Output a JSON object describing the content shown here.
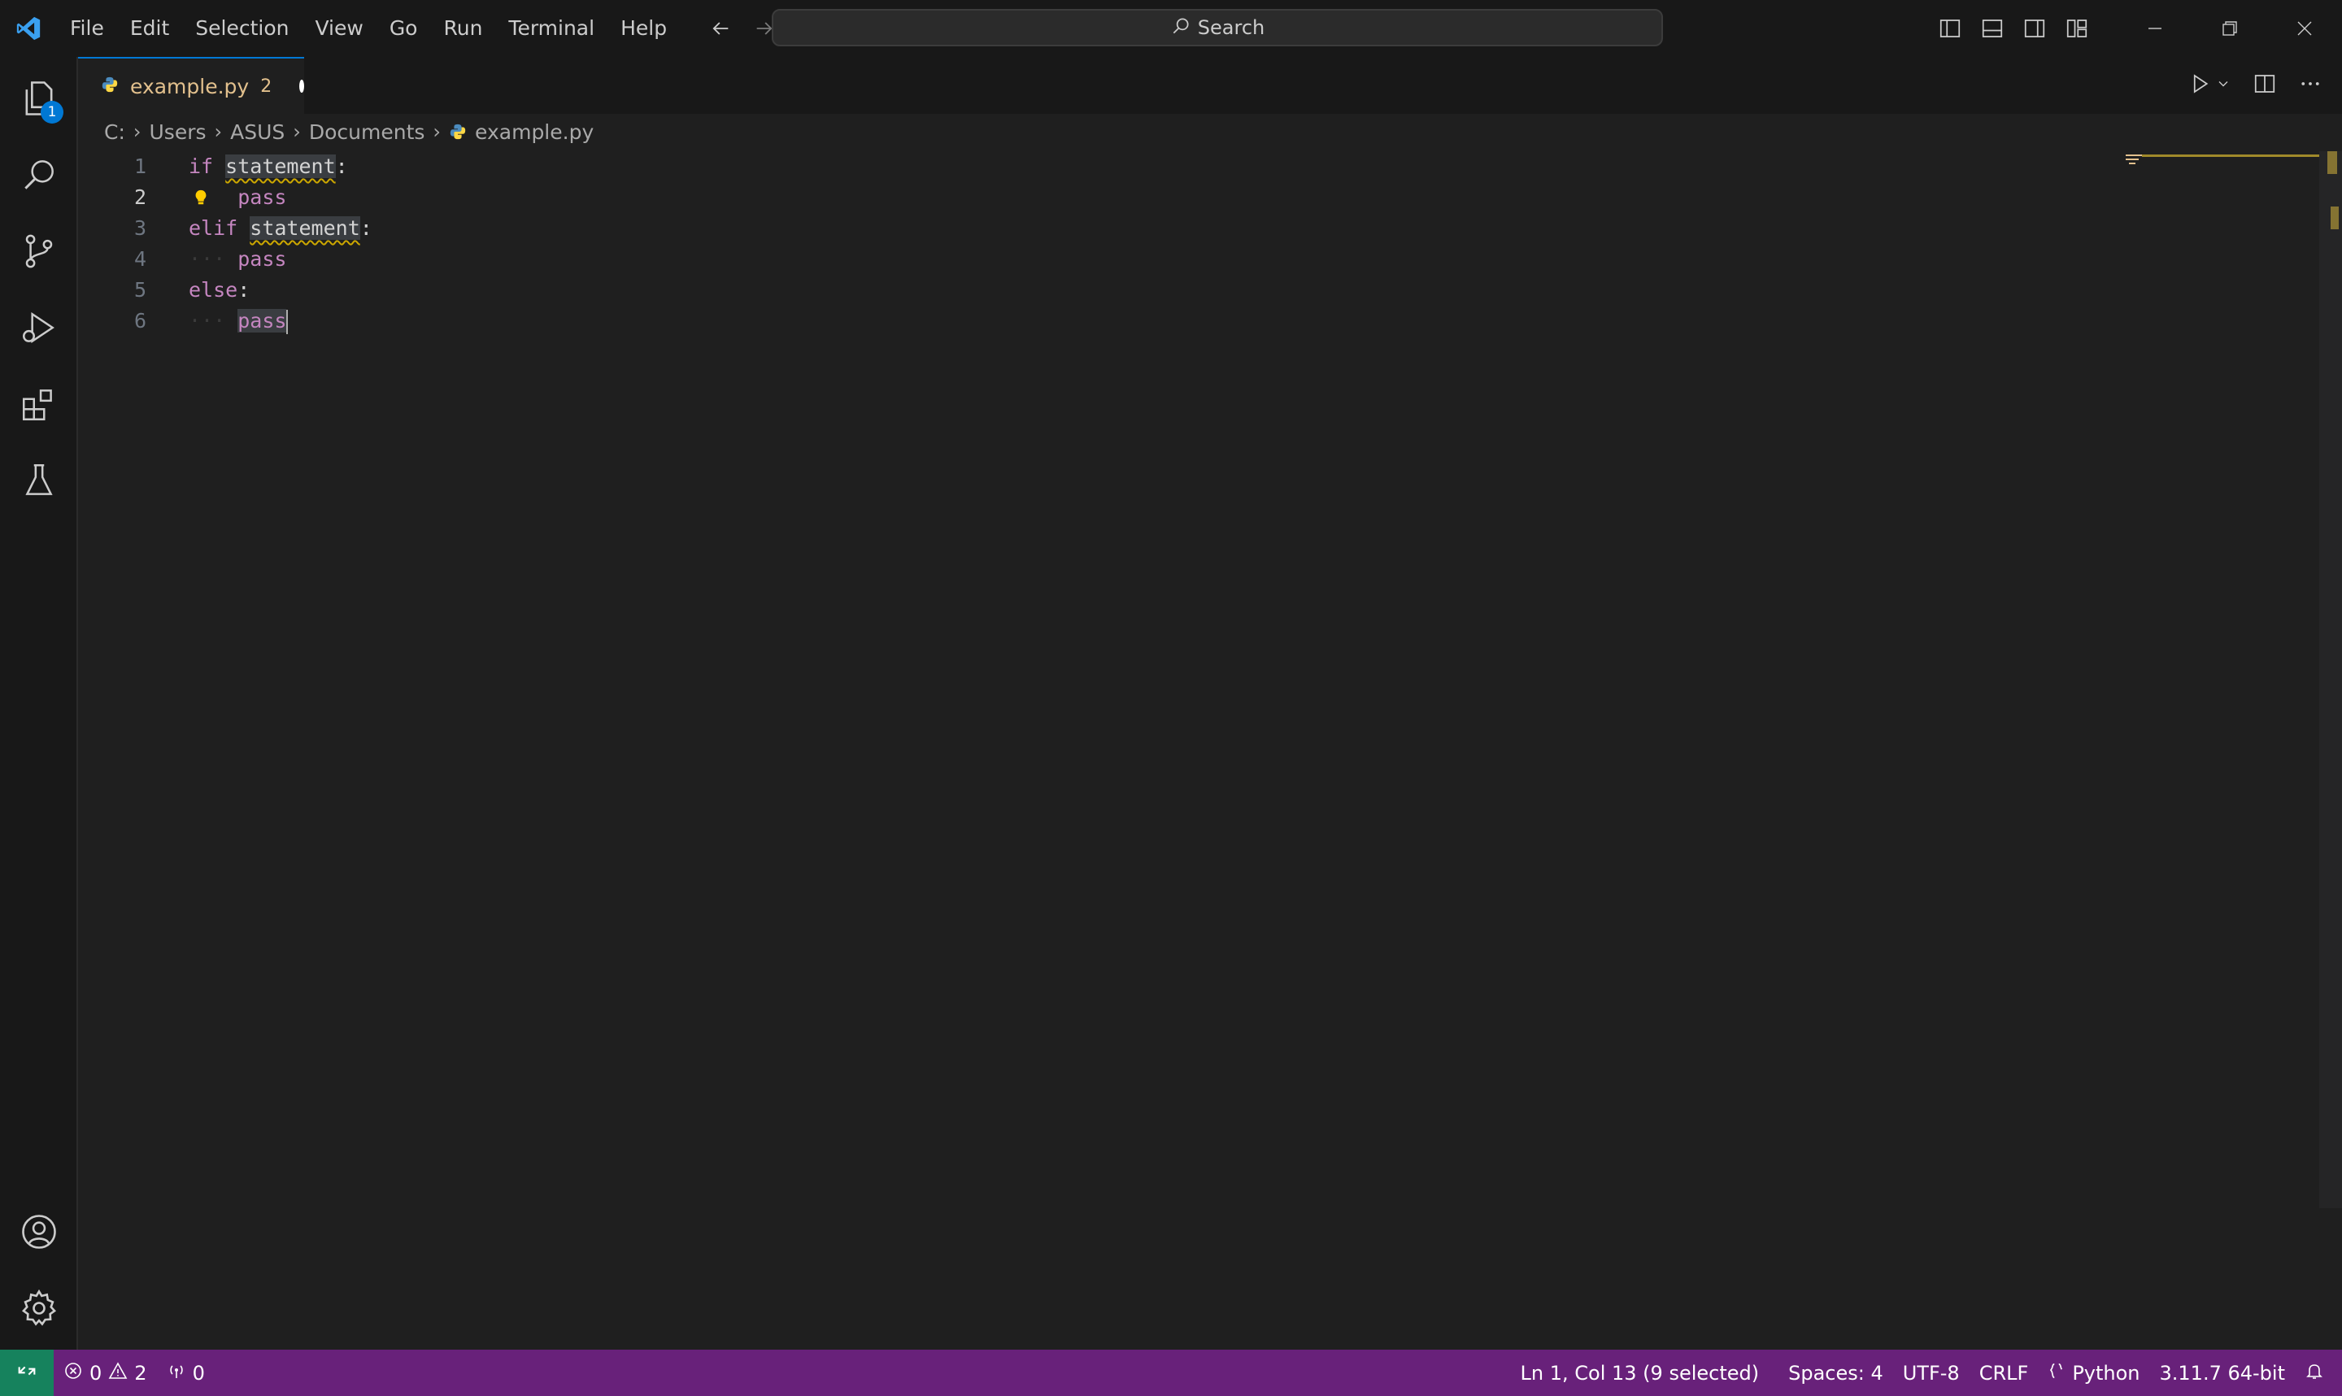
{
  "menu": [
    "File",
    "Edit",
    "Selection",
    "View",
    "Go",
    "Run",
    "Terminal",
    "Help"
  ],
  "search": {
    "label": "Search"
  },
  "activity": {
    "explorer_badge": "1"
  },
  "tab": {
    "name": "example.py",
    "problems": "2"
  },
  "breadcrumb": [
    "C:",
    "Users",
    "ASUS",
    "Documents",
    "example.py"
  ],
  "editor": {
    "line_numbers": [
      "1",
      "2",
      "3",
      "4",
      "5",
      "6"
    ],
    "lines": {
      "l1_kw": "if",
      "l1_sel": "statement",
      "l1_end": ":",
      "l2_kw": "pass",
      "l3_kw": "elif",
      "l3_sel": "statement",
      "l3_end": ":",
      "l4_kw": "pass",
      "l5_kw": "else",
      "l5_end": ":",
      "l6_kw": "pass"
    }
  },
  "status": {
    "errors": "0",
    "warnings": "2",
    "ports": "0",
    "position": "Ln 1, Col 13 (9 selected)",
    "spaces": "Spaces: 4",
    "encoding": "UTF-8",
    "eol": "CRLF",
    "language": "Python",
    "interpreter": "3.11.7 64-bit"
  },
  "colors": {
    "status_bg": "#68217a",
    "remote_bg": "#16825d",
    "accent": "#0078d4",
    "keyword": "#c586c0",
    "warning": "#cca700"
  }
}
